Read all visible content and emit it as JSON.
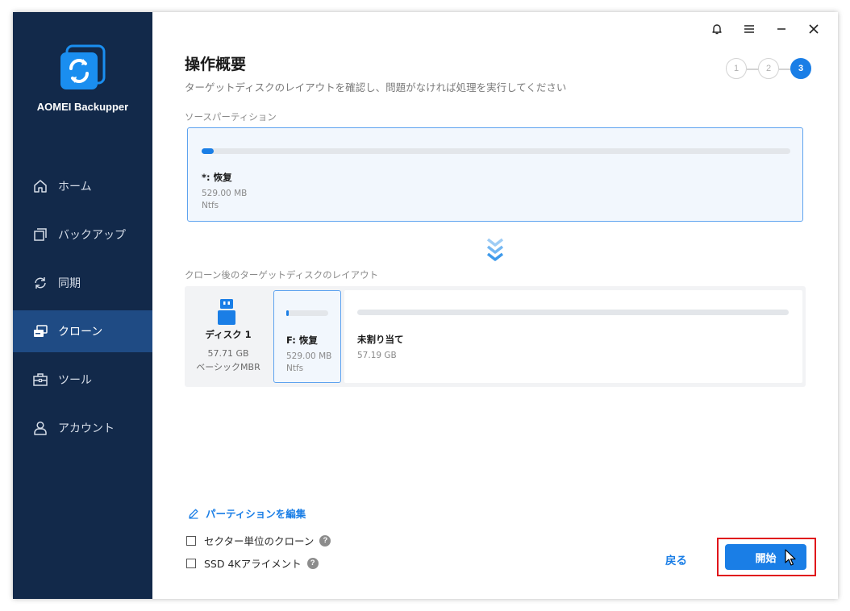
{
  "app": {
    "name": "AOMEI Backupper"
  },
  "sidebar": {
    "items": [
      {
        "label": "ホーム",
        "icon": "home-icon",
        "active": false
      },
      {
        "label": "バックアップ",
        "icon": "backup-icon",
        "active": false
      },
      {
        "label": "同期",
        "icon": "sync-icon",
        "active": false
      },
      {
        "label": "クローン",
        "icon": "clone-icon",
        "active": true
      },
      {
        "label": "ツール",
        "icon": "toolbox-icon",
        "active": false
      },
      {
        "label": "アカウント",
        "icon": "user-icon",
        "active": false
      }
    ]
  },
  "window_controls": [
    "bell-icon",
    "menu-icon",
    "minimize-icon",
    "close-icon"
  ],
  "header": {
    "title": "操作概要",
    "subtitle": "ターゲットディスクのレイアウトを確認し、問題がなければ処理を実行してください"
  },
  "steps": {
    "labels": [
      "1",
      "2",
      "3"
    ],
    "current": 3
  },
  "source": {
    "label": "ソースパーティション",
    "partition": {
      "name": "*: 恢复",
      "size": "529.00 MB",
      "fs": "Ntfs",
      "used_fraction": 0.02
    }
  },
  "target": {
    "label": "クローン後のターゲットディスクのレイアウト",
    "disk": {
      "name": "ディスク 1",
      "size": "57.71 GB",
      "type": "ベーシックMBR"
    },
    "partition": {
      "name": "F: 恢复",
      "size": "529.00 MB",
      "fs": "Ntfs",
      "used_fraction": 0.05
    },
    "unallocated": {
      "name": "未割り当て",
      "size": "57.19 GB",
      "used_fraction": 0
    }
  },
  "actions": {
    "edit_partition": "パーティションを編集",
    "sector_clone": "セクター単位のクローン",
    "ssd_align": "SSD 4Kアライメント",
    "help": "?",
    "back": "戻る",
    "start": "開始"
  },
  "colors": {
    "accent": "#1a7ee6",
    "sidebar": "#12294a",
    "sidebar_active": "#1f4b84",
    "highlight": "#e0161b"
  }
}
